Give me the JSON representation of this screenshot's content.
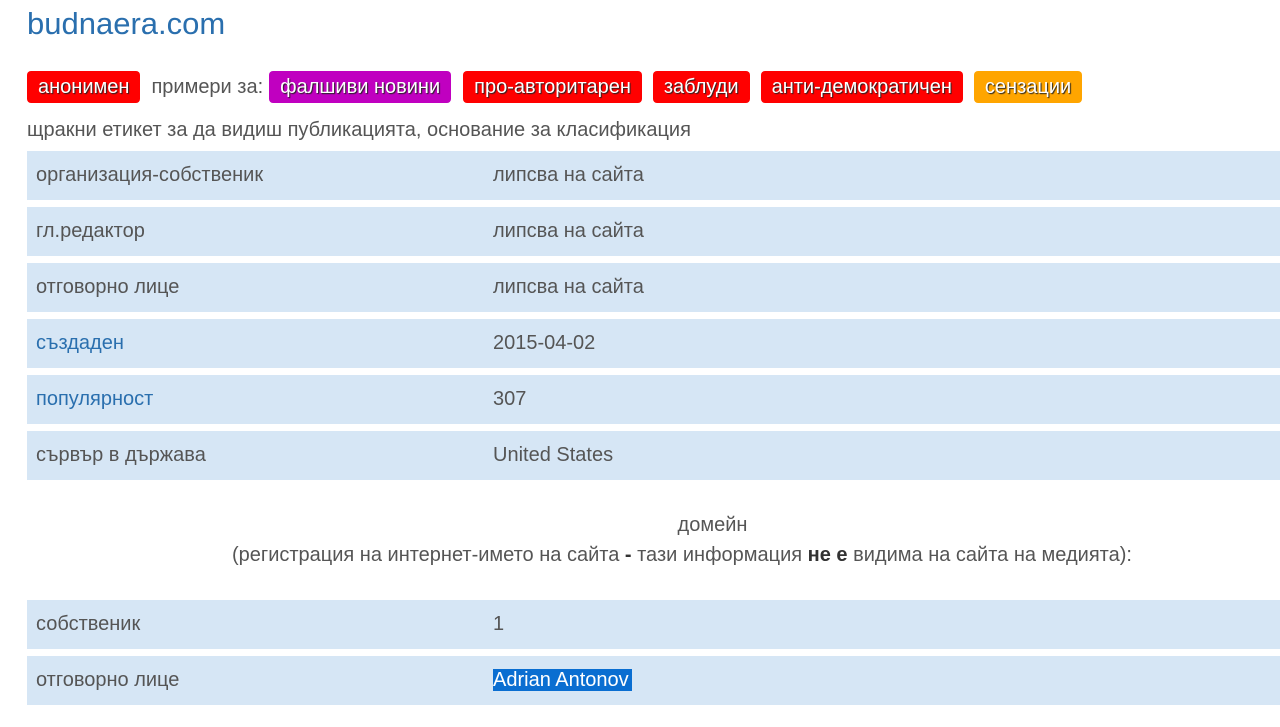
{
  "site": {
    "title": "budnaera.com"
  },
  "tags": {
    "anonymous": "анонимен",
    "examples_label": "примери за:",
    "items": [
      {
        "label": "фалшиви новини",
        "color": "#c000c0"
      },
      {
        "label": "про-авторитарен",
        "color": "#ff0000"
      },
      {
        "label": "заблуди",
        "color": "#ff0000"
      },
      {
        "label": "анти-демократичен",
        "color": "#ff0000"
      },
      {
        "label": "сензации",
        "color": "#ffa500"
      }
    ]
  },
  "hint": "щракни етикет за да видиш публикацията, основание за класификация",
  "site_info": {
    "rows": [
      {
        "key": "организация-собственик",
        "value": "липсва на сайта"
      },
      {
        "key": "гл.редактор",
        "value": "липсва на сайта"
      },
      {
        "key": "отговорно лице",
        "value": "липсва на сайта"
      },
      {
        "key": "създаден",
        "value": "2015-04-02"
      },
      {
        "key": "популярност",
        "value": "307"
      },
      {
        "key": "сървър в държава",
        "value": "United States"
      }
    ]
  },
  "domain": {
    "heading": "домейн",
    "note_before": "(регистрация на интернет-името на сайта",
    "note_dash": "-",
    "note_middle": "тази информация",
    "note_bold": "не е",
    "note_after": "видима на сайта на медията):",
    "rows": [
      {
        "key": "собственик",
        "value": "1"
      },
      {
        "key": "отговорно лице",
        "value": "Adrian Antonov"
      }
    ]
  },
  "colors": {
    "link": "#2a6fae",
    "row_background": "#d6e6f5",
    "selection": "#0a6ed1"
  }
}
